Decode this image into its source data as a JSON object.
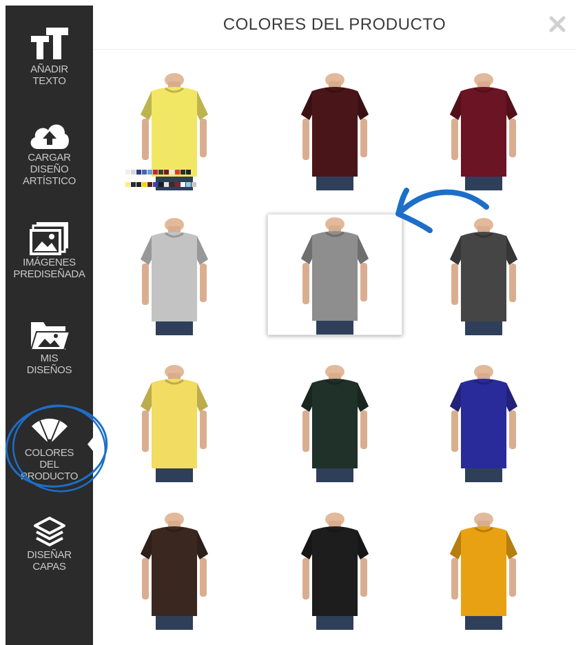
{
  "app": {
    "title": "COLORES DEL PRODUCTO"
  },
  "sidebar": {
    "items": [
      {
        "label": "AÑADIR\nTEXTO",
        "icon": "text-size-icon"
      },
      {
        "label": "CARGAR\nDISEÑO\nARTÍSTICO",
        "icon": "cloud-upload-icon"
      },
      {
        "label": "IMÁGENES\nPREDISEÑADA",
        "icon": "image-stack-icon"
      },
      {
        "label": "MIS\nDISEÑOS",
        "icon": "image-folder-icon"
      },
      {
        "label": "COLORES\nDEL\nPRODUCTO",
        "icon": "color-fan-icon",
        "active": true
      },
      {
        "label": "DISEÑAR\nCAPAS",
        "icon": "layers-icon"
      }
    ]
  },
  "header": {
    "close_icon": "close-icon"
  },
  "colors": [
    {
      "color": "#f2e764",
      "selected": false,
      "has_palette": true
    },
    {
      "color": "#4a1519",
      "selected": false
    },
    {
      "color": "#6b1423",
      "selected": false
    },
    {
      "color": "#c3c3c3",
      "selected": false
    },
    {
      "color": "#8e8e8e",
      "selected": true
    },
    {
      "color": "#454545",
      "selected": false
    },
    {
      "color": "#f2dc62",
      "selected": false
    },
    {
      "color": "#1f3128",
      "selected": false
    },
    {
      "color": "#2a2b9a",
      "selected": false
    },
    {
      "color": "#3a2820",
      "selected": false
    },
    {
      "color": "#1d1d1d",
      "selected": false
    },
    {
      "color": "#e8a112",
      "selected": false
    }
  ],
  "palette_colors": [
    "#eeeeee",
    "#d8d8d8",
    "#2c3c80",
    "#4a62b0",
    "#6fa0d8",
    "#b72a4a",
    "#3c3c3c",
    "#7a1a1e",
    "#e7e7e7",
    "#e0392b",
    "#2d2d2d",
    "#19223a",
    "#f7ef85",
    "#2b2b2b",
    "#222222",
    "#f2d300",
    "#5a1e1e",
    "#3a46a0",
    "#1d1d1d",
    "#e3e3e3",
    "#3d2b25",
    "#8a2030",
    "#ffffff",
    "#8fd0e8",
    "#c6c6c6"
  ],
  "annotation": {
    "color": "#1d6ec9"
  }
}
